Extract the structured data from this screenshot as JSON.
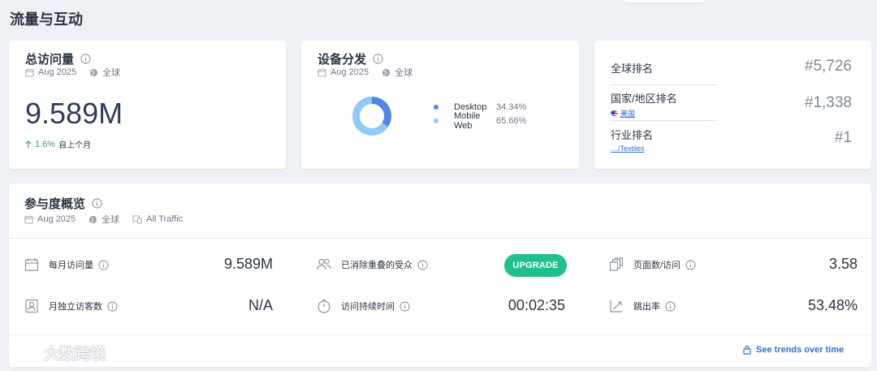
{
  "page": {
    "title": "流量与互动"
  },
  "visits_card": {
    "title": "总访问量",
    "date": "Aug 2025",
    "region": "全球",
    "value": "9.589M",
    "change_pct": "1.6%",
    "change_label": "自上个月",
    "change_color": "#3fa34d"
  },
  "device_card": {
    "title": "设备分发",
    "date": "Aug 2025",
    "region": "全球",
    "chart_data": {
      "type": "pie",
      "donut": true,
      "categories": [
        "Desktop",
        "Mobile Web"
      ],
      "values": [
        34.34,
        65.66
      ],
      "value_labels": [
        "34.34%",
        "65.66%"
      ],
      "colors": [
        "#4f86e6",
        "#90c9f6"
      ]
    }
  },
  "rank_card": {
    "global": {
      "label": "全球排名",
      "value": "#5,726"
    },
    "country": {
      "label": "国家/地区排名",
      "sub": "美国",
      "value": "#1,338"
    },
    "industry": {
      "label": "行业排名",
      "sub": "…/Textiles",
      "value": "#1"
    }
  },
  "engagement_card": {
    "title": "参与度概览",
    "date": "Aug 2025",
    "region": "全球",
    "traffic": "All Traffic",
    "metrics": {
      "monthly_visits": {
        "label": "每月访问量",
        "value": "9.589M",
        "icon": "calendar-icon"
      },
      "dedup_audience": {
        "label": "已消除重叠的受众",
        "button": "UPGRADE",
        "icon": "users-icon"
      },
      "pages_per_visit": {
        "label": "页面数/访问",
        "value": "3.58",
        "icon": "pages-icon"
      },
      "unique_visitors": {
        "label": "月独立访客数",
        "value": "N/A",
        "icon": "id-card-icon"
      },
      "visit_duration": {
        "label": "访问持续时间",
        "value": "00:02:35",
        "icon": "timer-icon"
      },
      "bounce_rate": {
        "label": "跳出率",
        "value": "53.48%",
        "icon": "bounce-icon"
      }
    },
    "trends_link": "See trends over time",
    "accent": "#1fc08e"
  },
  "watermark": {
    "text": "大数跨境"
  }
}
